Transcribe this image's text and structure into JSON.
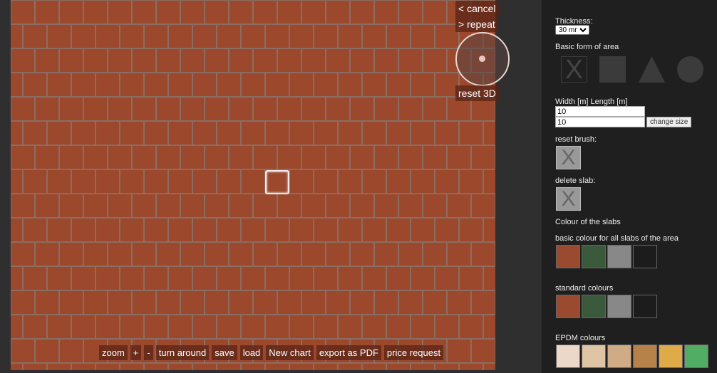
{
  "canvas_controls": {
    "cancel": "< cancel",
    "repeat": "> repeat",
    "reset3d": "reset 3D"
  },
  "toolbar": [
    "zoom",
    "+",
    "-",
    "turn around",
    "save",
    "load",
    "New chart",
    "export as PDF",
    "price request"
  ],
  "panel": {
    "thickness_label": "Thickness:",
    "thickness_value": "30 mm",
    "form_label": "Basic form of area",
    "shapes": [
      "none-icon",
      "square-icon",
      "triangle-icon",
      "circle-icon"
    ],
    "size_label": "Width [m] Length [m]",
    "width": "10",
    "length": "10",
    "change_size": "change size",
    "reset_brush": "reset brush:",
    "delete_slab": "delete slab:",
    "colour_heading": "Colour of the slabs",
    "basic_label": "basic colour for all slabs of the area",
    "basic_colours": [
      "#9a4a2e",
      "#3b5a3b",
      "#888888",
      "#1c1c1c"
    ],
    "standard_label": "standard colours",
    "standard_colours": [
      "#9a4a2e",
      "#3b5a3b",
      "#888888",
      "#1c1c1c"
    ],
    "epdm_label": "EPDM colours",
    "epdm_colours": [
      "#ebd8c8",
      "#dfc4a6",
      "#cfab86",
      "#b7824a",
      "#dfaa48",
      "#52ad64"
    ]
  },
  "colors": {
    "tile": "#9b482d",
    "grout": "#7a6a62"
  }
}
